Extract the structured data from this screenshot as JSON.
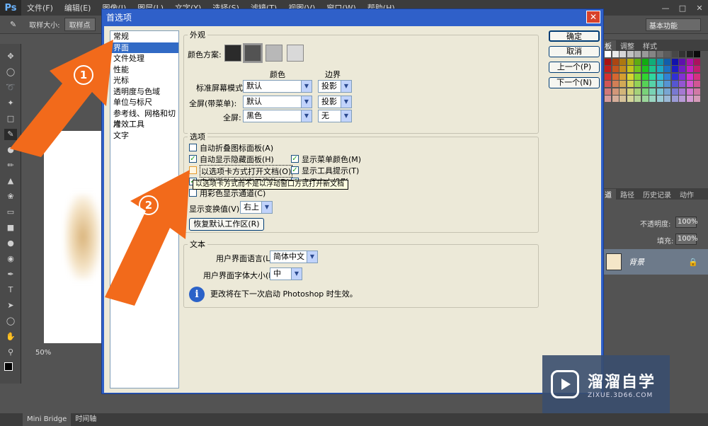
{
  "app": {
    "logo": "Ps",
    "menus": [
      "文件(F)",
      "编辑(E)",
      "图像(I)",
      "图层(L)",
      "文字(Y)",
      "选择(S)",
      "滤镜(T)",
      "视图(V)",
      "窗口(W)",
      "帮助(H)"
    ],
    "options_bar": {
      "sample_size_label": "取样大小:",
      "sample_size_value": "取样点"
    },
    "workspace": "基本功能",
    "zoom": "50%",
    "bottom_tabs": [
      "Mini Bridge",
      "时间轴"
    ]
  },
  "right_panel": {
    "top_tabs": [
      "板",
      "调整",
      "样式"
    ],
    "layer_tabs": [
      "道",
      "路径",
      "历史记录",
      "动作"
    ],
    "opacity_label": "不透明度:",
    "opacity_value": "100%",
    "fill_label": "填充:",
    "fill_value": "100%",
    "layer_name": "背景"
  },
  "dialog": {
    "title": "首选项",
    "categories": [
      "常规",
      "界面",
      "文件处理",
      "性能",
      "光标",
      "透明度与色域",
      "单位与标尺",
      "参考线、网格和切片",
      "增效工具",
      "文字"
    ],
    "selected_category": 1,
    "buttons": {
      "ok": "确定",
      "cancel": "取消",
      "prev": "上一个(P)",
      "next": "下一个(N)"
    },
    "appearance": {
      "legend": "外观",
      "color_scheme_label": "颜色方案:",
      "color_scheme_swatches": [
        "#2b2b2b",
        "#535353",
        "#b8b8b8",
        "#d9d9d9"
      ],
      "col_color": "颜色",
      "col_border": "边界",
      "rows": [
        {
          "label": "标准屏幕模式:",
          "color": "默认",
          "border": "投影"
        },
        {
          "label": "全屏(带菜单):",
          "color": "默认",
          "border": "投影"
        },
        {
          "label": "全屏:",
          "color": "黑色",
          "border": "无"
        }
      ]
    },
    "options": {
      "legend": "选项",
      "left": [
        {
          "label": "自动折叠图标面板(A)",
          "checked": false
        },
        {
          "label": "自动显示隐藏面板(H)",
          "checked": true
        },
        {
          "label": "以选项卡方式打开文档(O)",
          "checked": false
        },
        {
          "label": "启用浮动文档窗口停放(D)",
          "checked": true
        },
        {
          "label": "用彩色显示通道(C)",
          "checked": false
        }
      ],
      "right": [
        {
          "label": "显示菜单颜色(M)",
          "checked": true
        },
        {
          "label": "显示工具提示(T)",
          "checked": true
        },
        {
          "label": "启用文本投影",
          "checked": true
        }
      ],
      "transform_label": "显示变换值(V):",
      "transform_value": "右上",
      "restore_button": "恢复默认工作区(R)"
    },
    "text": {
      "legend": "文本",
      "ui_language_label": "用户界面语言(L):",
      "ui_language_value": "简体中文",
      "ui_font_size_label": "用户界面字体大小(E):",
      "ui_font_size_value": "中",
      "info": "更改将在下一次启动 Photoshop 时生效。"
    },
    "tooltip": "以选项卡方式而不是以浮动窗口方式打开新文档"
  },
  "annotations": {
    "marker1": "1",
    "marker2": "2",
    "arrow_color": "#f26a1b"
  },
  "watermark": {
    "title": "溜溜自学",
    "url": "ZIXUE.3D66.COM"
  }
}
